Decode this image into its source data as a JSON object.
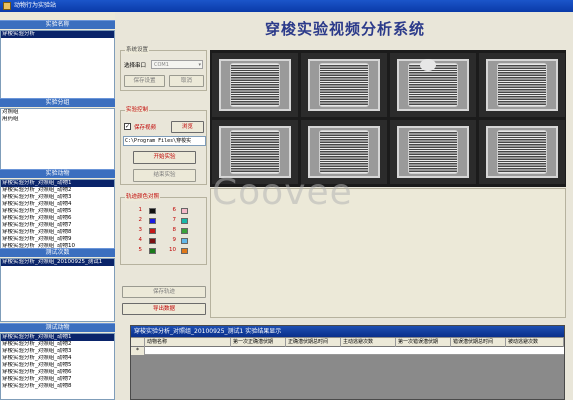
{
  "window": {
    "title": "动物行为实验站"
  },
  "app_title": "穿梭实验视频分析系统",
  "watermark": "Coovee",
  "left_panel": {
    "experiment_name": {
      "header": "实验名称",
      "items": [
        "穿梭实验分析"
      ]
    },
    "experiment_group": {
      "header": "实验分组",
      "items": [
        "对照组",
        "用药组"
      ]
    },
    "experiment_animals": {
      "header": "实验动物",
      "items": [
        "穿梭实验分析_对照组_动物1",
        "穿梭实验分析_对照组_动物2",
        "穿梭实验分析_对照组_动物3",
        "穿梭实验分析_对照组_动物4",
        "穿梭实验分析_对照组_动物5",
        "穿梭实验分析_对照组_动物6",
        "穿梭实验分析_对照组_动物7",
        "穿梭实验分析_对照组_动物8",
        "穿梭实验分析_对照组_动物9",
        "穿梭实验分析_对照组_动物10"
      ]
    },
    "test_count": {
      "header": "测试次数",
      "items": [
        "穿梭实验分析_对照组_20100925_测试1"
      ]
    },
    "test_animals": {
      "header": "测试动物",
      "items": [
        "穿梭实验分析_对照组_动物1",
        "穿梭实验分析_对照组_动物2",
        "穿梭实验分析_对照组_动物3",
        "穿梭实验分析_对照组_动物4",
        "穿梭实验分析_对照组_动物5",
        "穿梭实验分析_对照组_动物6",
        "穿梭实验分析_对照组_动物7",
        "穿梭实验分析_对照组_动物8"
      ]
    }
  },
  "system_settings": {
    "label": "系统设置",
    "port_label": "选择串口",
    "port_value": "COM1",
    "save_settings": "保存设置",
    "cancel": "取消"
  },
  "experiment_control": {
    "label": "实验控制",
    "save_video_label": "保存视频",
    "save_video_checked": true,
    "browse": "浏览",
    "path_value": "C:\\Program Files\\穿梭实",
    "start": "开始实验",
    "end": "结束实验"
  },
  "track_colors": {
    "label": "轨迹颜色对照",
    "items": [
      {
        "n": "1",
        "color": "#111111"
      },
      {
        "n": "2",
        "color": "#1a1ae0"
      },
      {
        "n": "3",
        "color": "#c41a1a"
      },
      {
        "n": "4",
        "color": "#7a1212"
      },
      {
        "n": "5",
        "color": "#1a7a1a"
      },
      {
        "n": "6",
        "color": "#f4b8c8"
      },
      {
        "n": "7",
        "color": "#18b8a8"
      },
      {
        "n": "8",
        "color": "#3aa23a"
      },
      {
        "n": "9",
        "color": "#62b8e8"
      },
      {
        "n": "10",
        "color": "#e07818"
      }
    ]
  },
  "save_track": "保存轨迹",
  "export_data": "导出数据",
  "results": {
    "title": "穿梭实验分析_对照组_20100925_测试1  实验结果显示",
    "row_marker": "*",
    "columns": [
      "动物名称",
      "第一次正确潜伏期",
      "正确潜伏期总时间",
      "主动逃避次数",
      "第一次错误潜伏期",
      "错误潜伏期总时间",
      "被动逃避次数"
    ]
  },
  "colors": {
    "accent": "#3b6fbf",
    "title_blue": "#2b3a8a",
    "label_red": "#c00000"
  }
}
